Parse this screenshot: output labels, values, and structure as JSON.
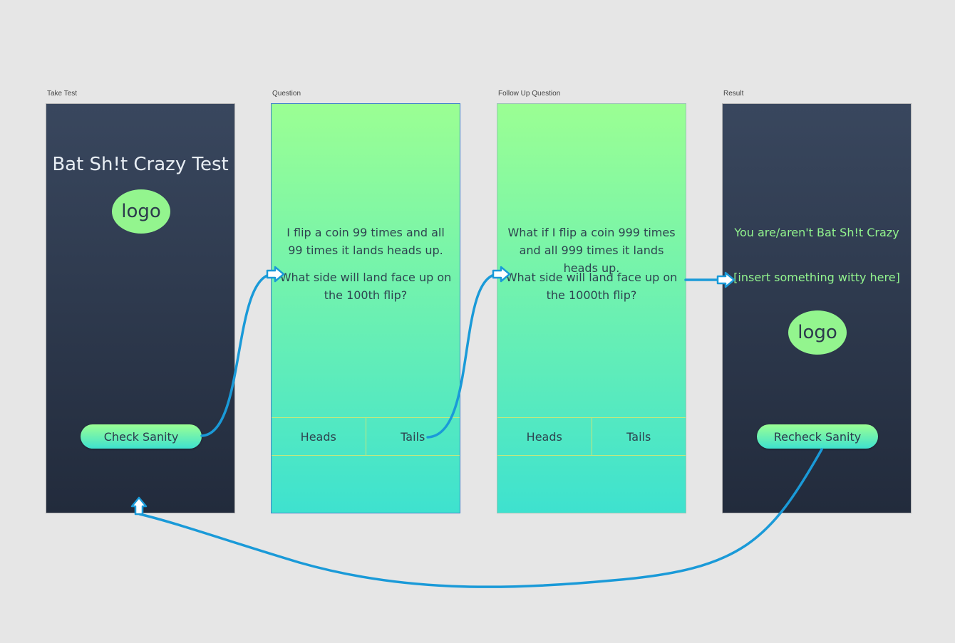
{
  "artboards": {
    "take_test": "Take Test",
    "question": "Question",
    "follow_up": "Follow Up Question",
    "result": "Result"
  },
  "take_test": {
    "title": "Bat Sh!t Crazy Test",
    "logo": "logo",
    "button": "Check Sanity"
  },
  "question": {
    "line1": "I flip a coin 99 times and all 99 times it lands heads up.",
    "line2": "What side will land face up on the 100th flip?",
    "heads": "Heads",
    "tails": "Tails"
  },
  "follow_up": {
    "line1": "What if I flip a coin 999 times and all 999 times it lands heads up.",
    "line2": "What side will land face up on the 1000th flip?",
    "heads": "Heads",
    "tails": "Tails"
  },
  "result": {
    "line1": "You are/aren't Bat Sh!t Crazy",
    "line2": "[insert something witty here]",
    "logo": "logo",
    "button": "Recheck Sanity"
  },
  "colors": {
    "background": "#e6e6e6",
    "dark_top": "#39475e",
    "dark_bottom": "#222b3c",
    "green_top": "#9bff93",
    "green_bottom": "#3ee2cf",
    "flow_arrow": "#1a9ad8"
  },
  "icons": {
    "flow_connector": "arrow-icon"
  }
}
